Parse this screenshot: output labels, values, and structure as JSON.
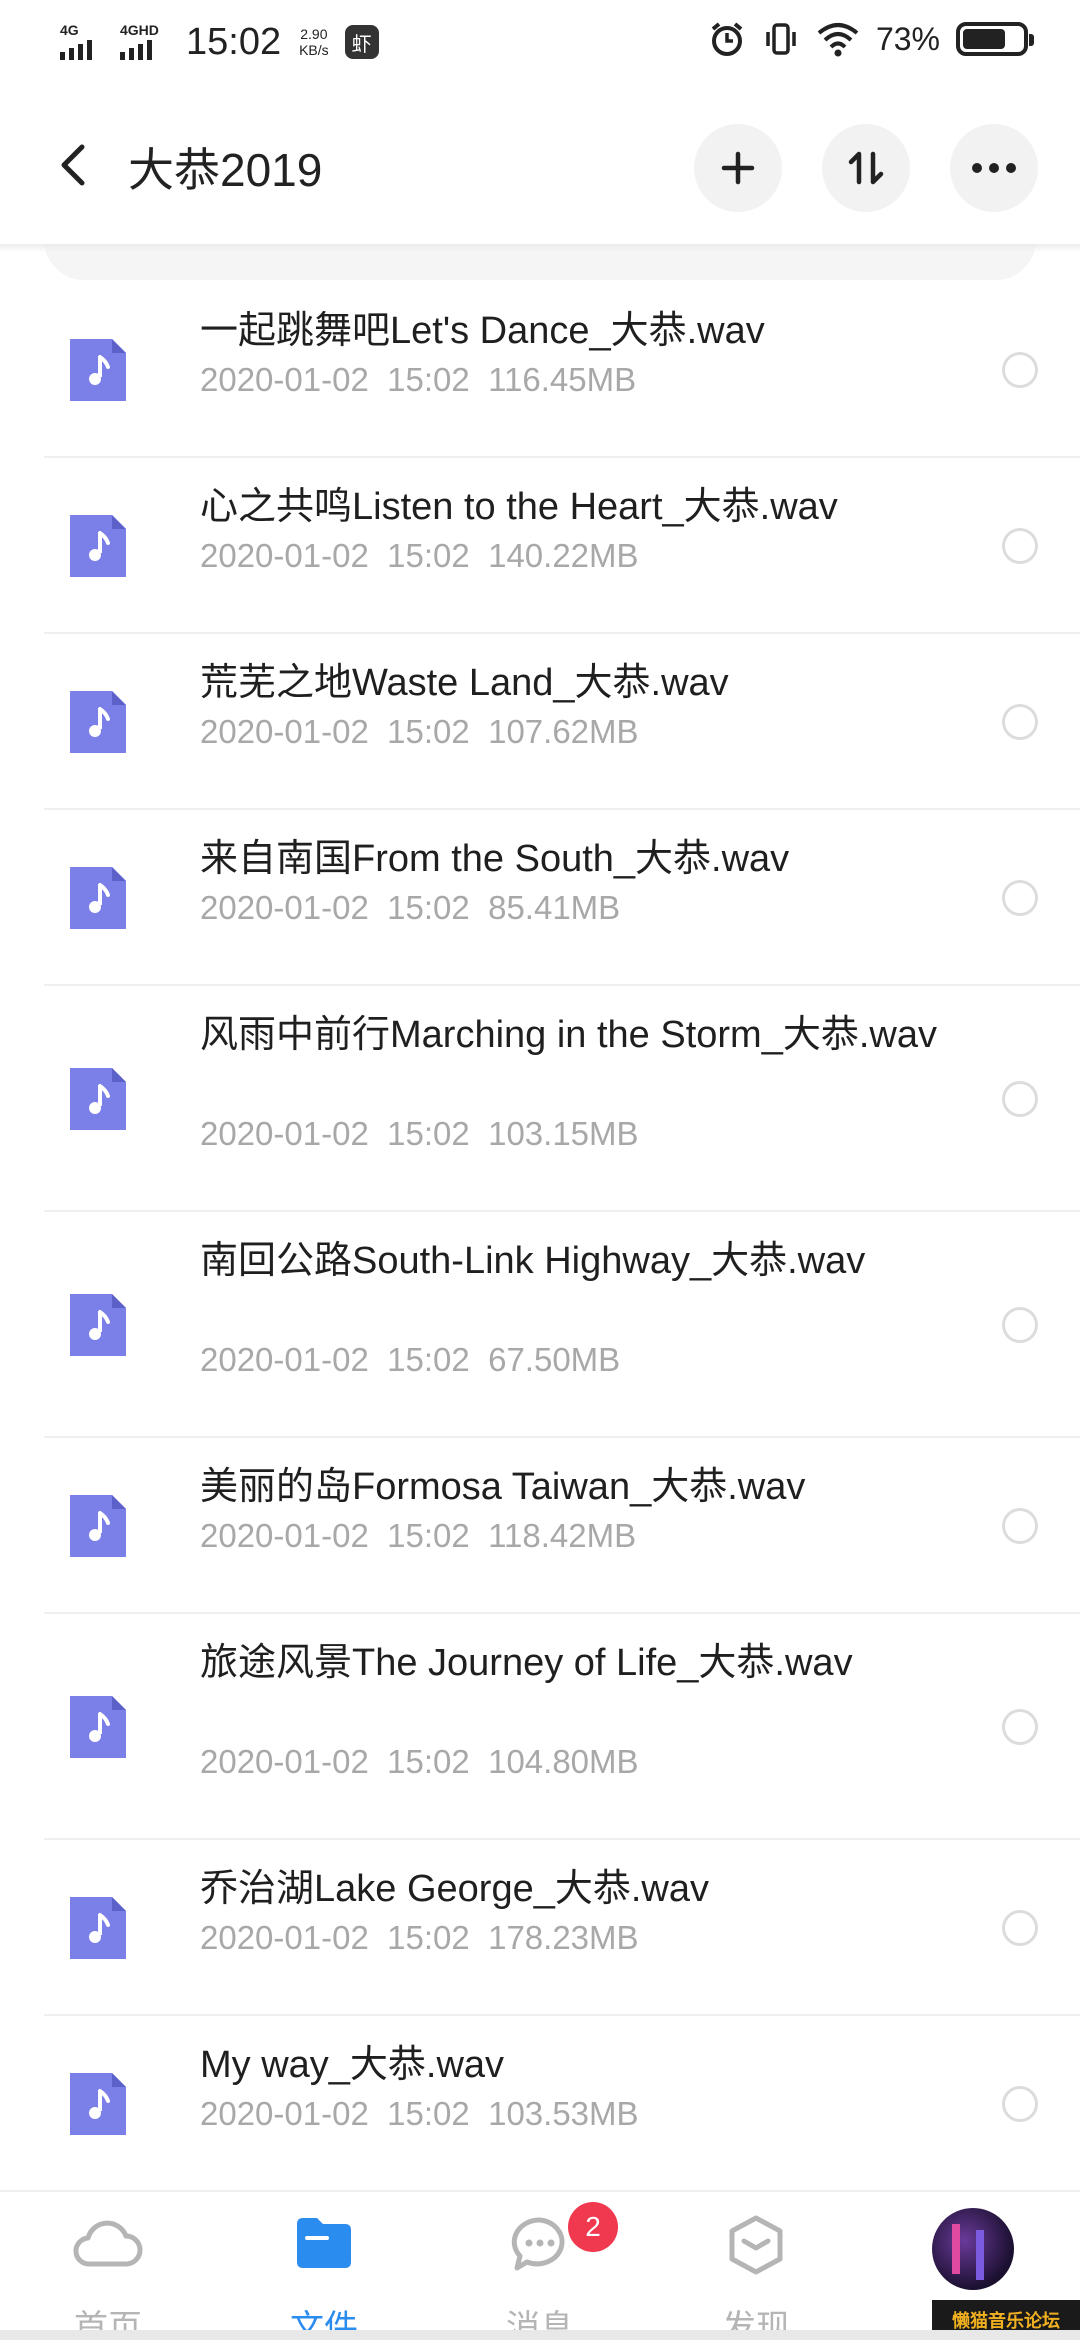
{
  "status_bar": {
    "network1": "4G",
    "network2": "4GHD",
    "time": "15:02",
    "speed_value": "2.90",
    "speed_unit": "KB/s",
    "app_badge": "虾",
    "battery_percent": "73%",
    "battery_level": 0.73
  },
  "header": {
    "title": "大恭2019",
    "back_icon": "chevron-left-icon",
    "add_icon": "plus-icon",
    "sort_icon": "sort-arrows-icon",
    "more_icon": "more-dots-icon"
  },
  "files": [
    {
      "name": "一起跳舞吧Let's Dance_大恭.wav",
      "date": "2020-01-02",
      "time": "15:02",
      "size": "116.45MB"
    },
    {
      "name": "心之共鸣Listen to the Heart_大恭.wav",
      "date": "2020-01-02",
      "time": "15:02",
      "size": "140.22MB"
    },
    {
      "name": "荒芜之地Waste Land_大恭.wav",
      "date": "2020-01-02",
      "time": "15:02",
      "size": "107.62MB"
    },
    {
      "name": "来自南国From the South_大恭.wav",
      "date": "2020-01-02",
      "time": "15:02",
      "size": "85.41MB"
    },
    {
      "name": "风雨中前行Marching in the Storm_大恭.wav",
      "date": "2020-01-02",
      "time": "15:02",
      "size": "103.15MB"
    },
    {
      "name": "南回公路South-Link Highway_大恭.wav",
      "date": "2020-01-02",
      "time": "15:02",
      "size": "67.50MB"
    },
    {
      "name": "美丽的岛Formosa Taiwan_大恭.wav",
      "date": "2020-01-02",
      "time": "15:02",
      "size": "118.42MB"
    },
    {
      "name": "旅途风景The Journey of Life_大恭.wav",
      "date": "2020-01-02",
      "time": "15:02",
      "size": "104.80MB"
    },
    {
      "name": "乔治湖Lake George_大恭.wav",
      "date": "2020-01-02",
      "time": "15:02",
      "size": "178.23MB"
    },
    {
      "name": "My way_大恭.wav",
      "date": "2020-01-02",
      "time": "15:02",
      "size": "103.53MB"
    }
  ],
  "bottom_nav": {
    "home": "首页",
    "files": "文件",
    "messages": "消息",
    "discover": "发现",
    "messages_badge": "2",
    "active_color": "#2b8cf0"
  },
  "watermark": "懒猫音乐论坛",
  "colors": {
    "file_icon": "#7b7fe8",
    "accent": "#2b8cf0",
    "badge": "#f0384f"
  }
}
